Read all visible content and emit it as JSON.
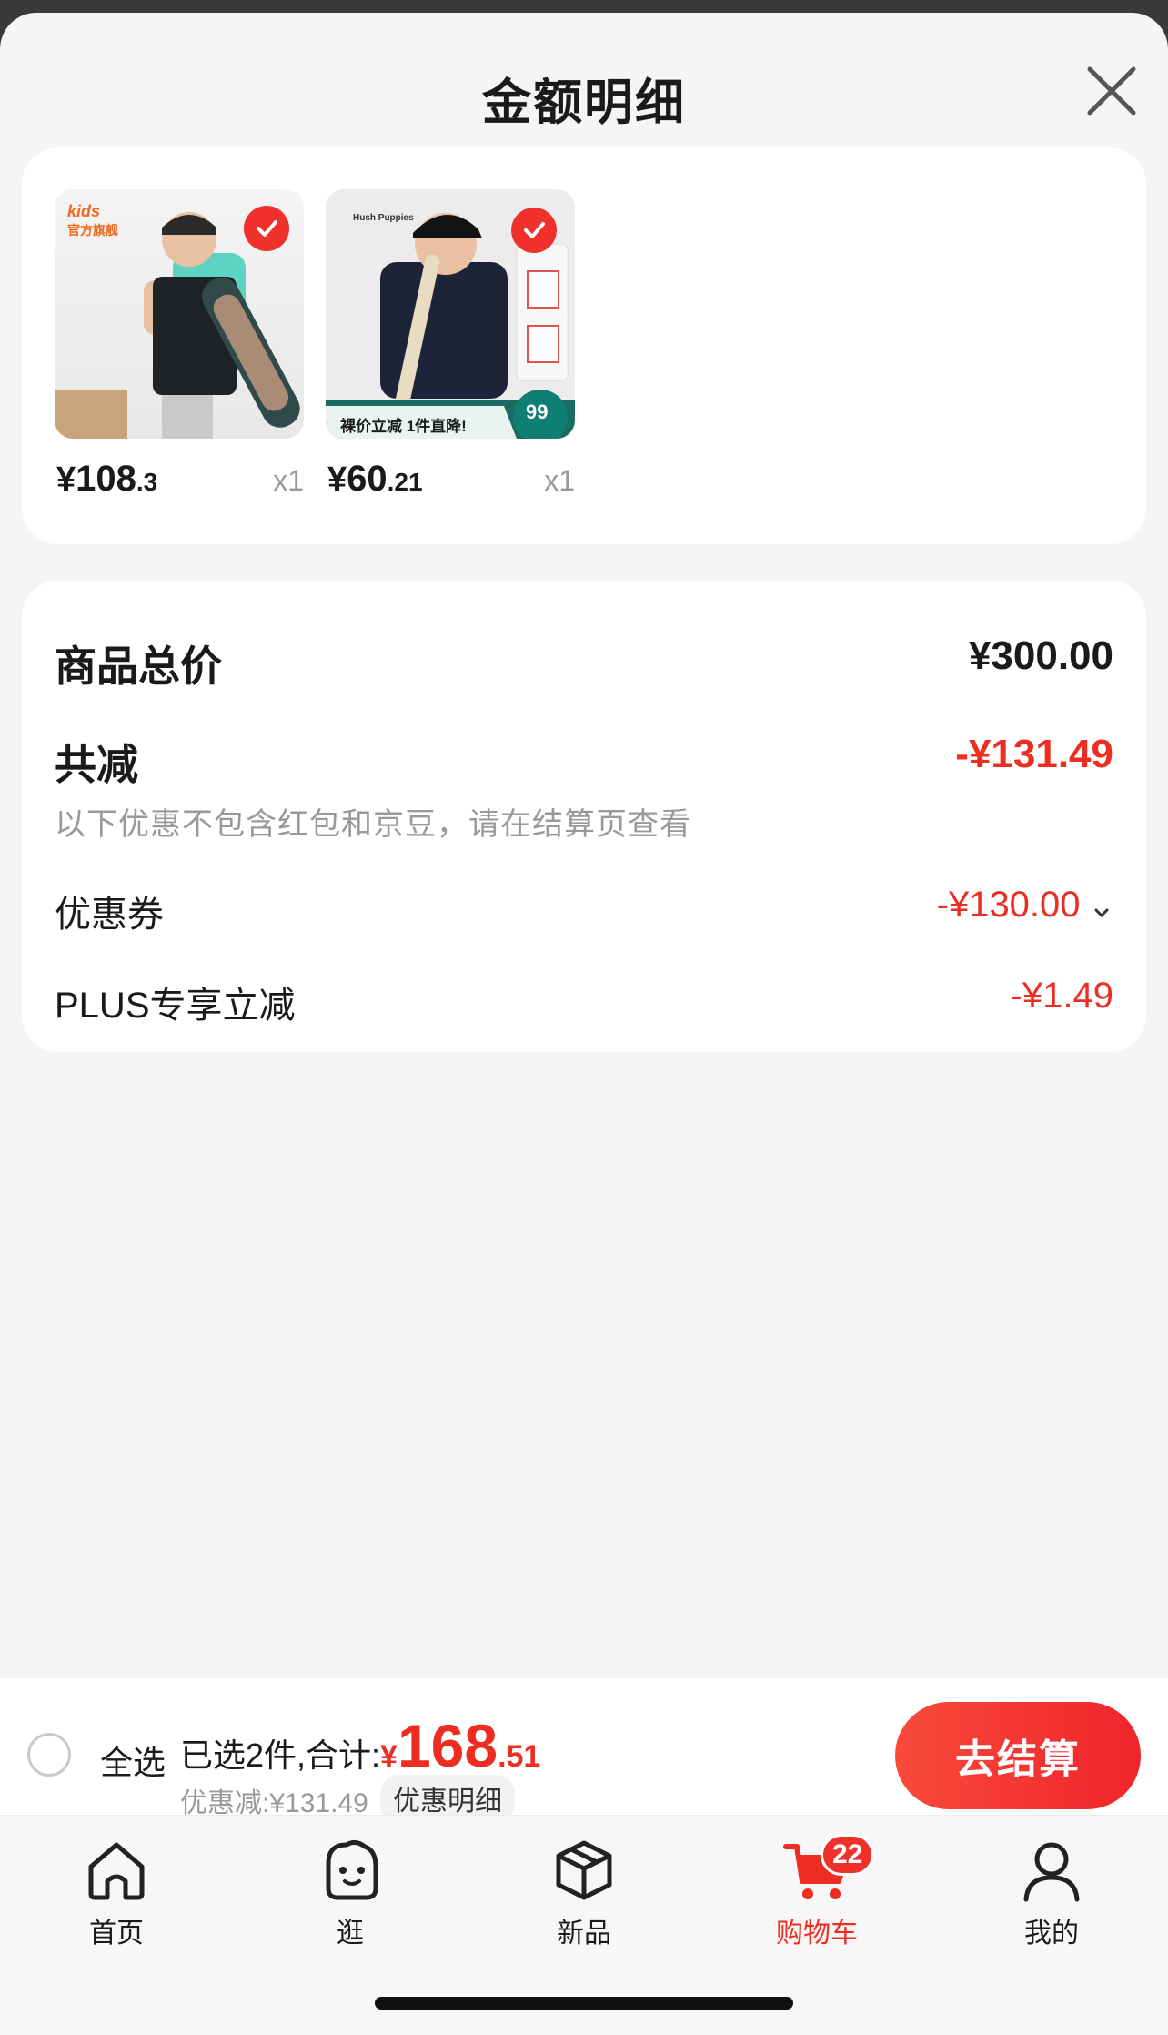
{
  "sheet": {
    "title": "金额明细"
  },
  "products": [
    {
      "brand_text": "kids",
      "brand_sub": "官方旗舰",
      "price_yen": "¥",
      "price_int": "108",
      "price_cents": ".3",
      "qty": "x1"
    },
    {
      "brand_text": "Hush Puppies",
      "promo_text": "裸价立减 1件直降!",
      "promo_price": "99",
      "price_yen": "¥",
      "price_int": "60",
      "price_cents": ".21",
      "qty": "x1"
    }
  ],
  "summary": {
    "total_label": "商品总价",
    "total_value": "¥300.00",
    "reduce_label": "共减",
    "reduce_value": "-¥131.49",
    "note": "以下优惠不包含红包和京豆，请在结算页查看",
    "coupon_label": "优惠券",
    "coupon_value": "-¥130.00",
    "plus_label": "PLUS专享立减",
    "plus_value": "-¥1.49"
  },
  "bottom": {
    "select_all": "全选",
    "selected_text": "已选2件,合计:",
    "total_yen": "¥",
    "total_int": "168",
    "total_cents": ".51",
    "discount_text": "优惠减:¥131.49",
    "detail_chip": "优惠明细",
    "checkout": "去结算"
  },
  "tabs": [
    {
      "label": "首页",
      "icon": "home-icon"
    },
    {
      "label": "逛",
      "icon": "browse-face-icon"
    },
    {
      "label": "新品",
      "icon": "new-products-cube-icon"
    },
    {
      "label": "购物车",
      "icon": "cart-icon",
      "badge": "22",
      "active": true
    },
    {
      "label": "我的",
      "icon": "user-icon"
    }
  ],
  "colors": {
    "accent": "#ee2d22",
    "background": "#f5f5f5"
  }
}
